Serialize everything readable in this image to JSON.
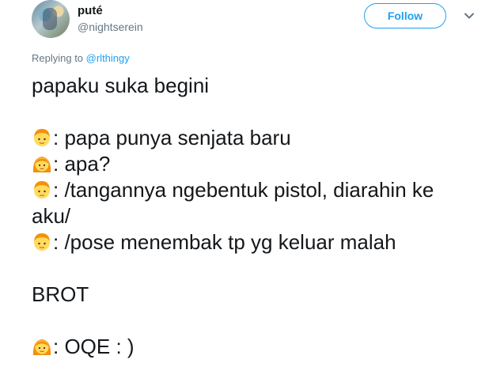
{
  "user": {
    "display_name": "puté",
    "handle": "@nightserein"
  },
  "follow_label": "Follow",
  "reply": {
    "prefix": "Replying to ",
    "to": "@rlthingy"
  },
  "tweet": {
    "line1": "papaku suka begini",
    "line2": ": papa punya senjata baru",
    "line3": ": apa?",
    "line4": ": /tangannya ngebentuk pistol, diarahin ke",
    "line5": "aku/",
    "line6": ": /pose menembak tp yg keluar malah",
    "line7": "BROT",
    "line8": ": OQE : )"
  },
  "icons": {
    "caret": "chevron-down-icon",
    "papa": "person-blond-hair-emoji",
    "kid": "girl-emoji"
  },
  "colors": {
    "accent": "#1da1f2",
    "muted": "#657786",
    "text": "#14171a"
  }
}
